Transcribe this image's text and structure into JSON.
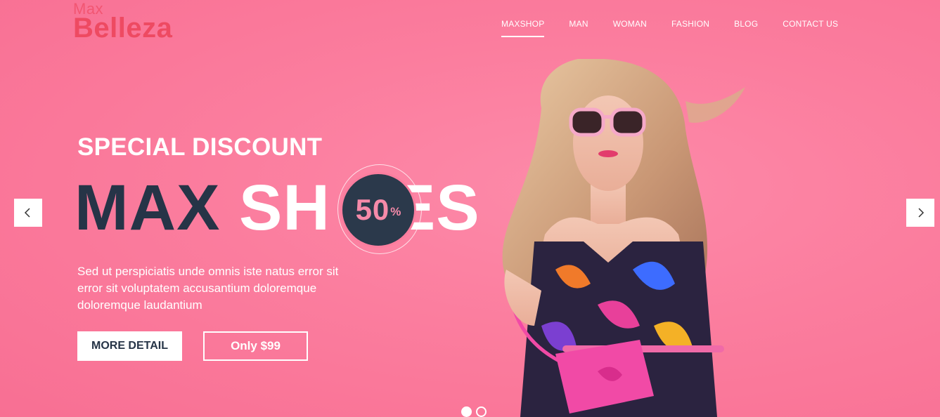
{
  "brand": {
    "small": "Max",
    "big": "Belleza",
    "color": "#ee4a62"
  },
  "nav": {
    "items": [
      {
        "label": "MAXSHOP",
        "active": true
      },
      {
        "label": "MAN"
      },
      {
        "label": "WOMAN"
      },
      {
        "label": "FASHION"
      },
      {
        "label": "BLOG"
      },
      {
        "label": "CONTACT US"
      }
    ]
  },
  "hero": {
    "subtitle": "SPECIAL DISCOUNT",
    "headline_dark": "MAX",
    "headline_light_a": "SH",
    "headline_light_b": "ES",
    "badge_number": "50",
    "badge_symbol": "%",
    "description": "Sed ut perspiciatis unde omnis iste natus error sit error sit voluptatem accusantium doloremque doloremque laudantium",
    "cta_detail": "MORE DETAIL",
    "cta_price": "Only $99"
  },
  "slider": {
    "prev_icon": "chevron-left-icon",
    "next_icon": "chevron-right-icon",
    "slide_count": 2,
    "active_slide": 1
  },
  "colors": {
    "background": "#fb7d9e",
    "dark_text": "#263447",
    "badge_bg": "#2b394b",
    "badge_text": "#f58aa9"
  }
}
